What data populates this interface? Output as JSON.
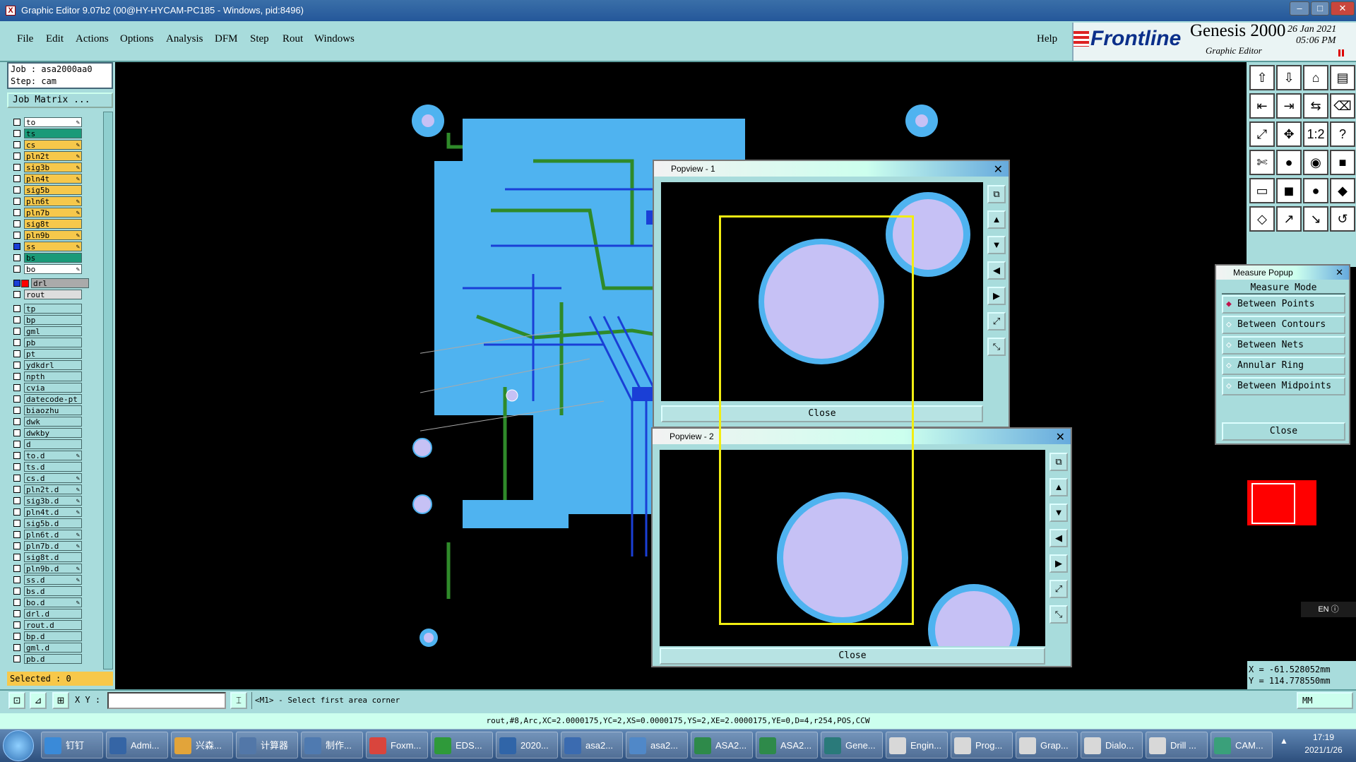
{
  "window": {
    "title": "Graphic Editor 9.07b2 (00@HY-HYCAM-PC185 - Windows, pid:8496)",
    "icon": "app-x-icon"
  },
  "menu": [
    "File",
    "Edit",
    "Actions",
    "Options",
    "Analysis",
    "DFM",
    "Step",
    "Rout",
    "Windows"
  ],
  "help_label": "Help",
  "brand": {
    "logo": "Frontline",
    "product": "Genesis 2000",
    "subtitle": "Graphic Editor",
    "date": "26 Jan 2021",
    "time": "05:06 PM"
  },
  "job": {
    "job_line": "Job : asa2000aa0",
    "step_line": "Step: cam",
    "matrix_button": "Job Matrix ..."
  },
  "layers": [
    {
      "name": "to",
      "color": "#ffffff",
      "edit": true
    },
    {
      "name": "ts",
      "color": "#1a9a78",
      "edit": false
    },
    {
      "name": "cs",
      "color": "#f6c84b",
      "edit": true
    },
    {
      "name": "pln2t",
      "color": "#f6c84b",
      "edit": true
    },
    {
      "name": "sig3b",
      "color": "#f6c84b",
      "edit": true
    },
    {
      "name": "pln4t",
      "color": "#f6c84b",
      "edit": true
    },
    {
      "name": "sig5b",
      "color": "#f6c84b",
      "edit": false
    },
    {
      "name": "pln6t",
      "color": "#f6c84b",
      "edit": true
    },
    {
      "name": "pln7b",
      "color": "#f6c84b",
      "edit": true
    },
    {
      "name": "sig8t",
      "color": "#f6c84b",
      "edit": false
    },
    {
      "name": "pln9b",
      "color": "#f6c84b",
      "edit": true
    },
    {
      "name": "ss",
      "color": "#f6c84b",
      "edit": true
    },
    {
      "name": "bs",
      "color": "#1a9a78",
      "edit": false
    },
    {
      "name": "bo",
      "color": "#ffffff",
      "edit": true
    },
    {
      "name": "drl",
      "color": "#aaaaaa",
      "edit": false
    },
    {
      "name": "rout",
      "color": "#dddddd",
      "edit": false
    },
    {
      "name": "tp",
      "color": "#a8dcdc",
      "edit": false
    },
    {
      "name": "bp",
      "color": "#a8dcdc",
      "edit": false
    },
    {
      "name": "gml",
      "color": "#a8dcdc",
      "edit": false
    },
    {
      "name": "pb",
      "color": "#a8dcdc",
      "edit": false
    },
    {
      "name": "pt",
      "color": "#a8dcdc",
      "edit": false
    },
    {
      "name": "ydkdrl",
      "color": "#a8dcdc",
      "edit": false
    },
    {
      "name": "npth",
      "color": "#a8dcdc",
      "edit": false
    },
    {
      "name": "cvia",
      "color": "#a8dcdc",
      "edit": false
    },
    {
      "name": "datecode-pt",
      "color": "#a8dcdc",
      "edit": false
    },
    {
      "name": "biaozhu",
      "color": "#a8dcdc",
      "edit": false
    },
    {
      "name": "dwk",
      "color": "#a8dcdc",
      "edit": false
    },
    {
      "name": "dwkby",
      "color": "#a8dcdc",
      "edit": false
    },
    {
      "name": "d",
      "color": "#a8dcdc",
      "edit": false
    },
    {
      "name": "to.d",
      "color": "#a8dcdc",
      "edit": true
    },
    {
      "name": "ts.d",
      "color": "#a8dcdc",
      "edit": false
    },
    {
      "name": "cs.d",
      "color": "#a8dcdc",
      "edit": true
    },
    {
      "name": "pln2t.d",
      "color": "#a8dcdc",
      "edit": true
    },
    {
      "name": "sig3b.d",
      "color": "#a8dcdc",
      "edit": true
    },
    {
      "name": "pln4t.d",
      "color": "#a8dcdc",
      "edit": true
    },
    {
      "name": "sig5b.d",
      "color": "#a8dcdc",
      "edit": false
    },
    {
      "name": "pln6t.d",
      "color": "#a8dcdc",
      "edit": true
    },
    {
      "name": "pln7b.d",
      "color": "#a8dcdc",
      "edit": true
    },
    {
      "name": "sig8t.d",
      "color": "#a8dcdc",
      "edit": false
    },
    {
      "name": "pln9b.d",
      "color": "#a8dcdc",
      "edit": true
    },
    {
      "name": "ss.d",
      "color": "#a8dcdc",
      "edit": true
    },
    {
      "name": "bs.d",
      "color": "#a8dcdc",
      "edit": false
    },
    {
      "name": "bo.d",
      "color": "#a8dcdc",
      "edit": true
    },
    {
      "name": "drl.d",
      "color": "#a8dcdc",
      "edit": false
    },
    {
      "name": "rout.d",
      "color": "#a8dcdc",
      "edit": false
    },
    {
      "name": "bp.d",
      "color": "#a8dcdc",
      "edit": false
    },
    {
      "name": "gml.d",
      "color": "#a8dcdc",
      "edit": false
    },
    {
      "name": "pb.d",
      "color": "#a8dcdc",
      "edit": false
    }
  ],
  "selected": "Selected : 0",
  "popview1": {
    "title": "Popview - 1",
    "close": "Close"
  },
  "popview2": {
    "title": "Popview - 2",
    "close": "Close"
  },
  "measure": {
    "title": "Measure Popup",
    "heading": "Measure Mode",
    "options": [
      "Between Points",
      "Between Contours",
      "Between Nets",
      "Annular Ring",
      "Between Midpoints"
    ],
    "selected_index": 0,
    "close": "Close"
  },
  "coords": {
    "x": "X = -61.528052mm",
    "y": "Y = 114.778550mm"
  },
  "lang": "EN",
  "units_button": "MM",
  "status": {
    "xy_label": "X Y :",
    "xy_value": "",
    "message": "<M1> - Select first area corner"
  },
  "cmdline": "rout,#8,Arc,XC=2.0000175,YC=2,XS=0.0000175,YS=2,XE=2.0000175,YE=0,D=4,r254,POS,CCW",
  "taskbar": {
    "items": [
      "钉钉",
      "Admi...",
      "兴森...",
      "计算器",
      "制作...",
      "Foxm...",
      "EDS...",
      "2020...",
      "asa2...",
      "asa2...",
      "ASA2...",
      "ASA2...",
      "Gene...",
      "Engin...",
      "Prog...",
      "Grap...",
      "Dialo...",
      "Drill ...",
      "CAM..."
    ],
    "time": "17:19",
    "date": "2021/1/26"
  },
  "colors": {
    "panel": "#a8dcdc",
    "board_copper": "#4fb3f0",
    "board_trace": "#1a3fd6",
    "board_green": "#2f8a2a",
    "pad_fill": "#c6c1f5",
    "highlight": "#f2ee12"
  }
}
